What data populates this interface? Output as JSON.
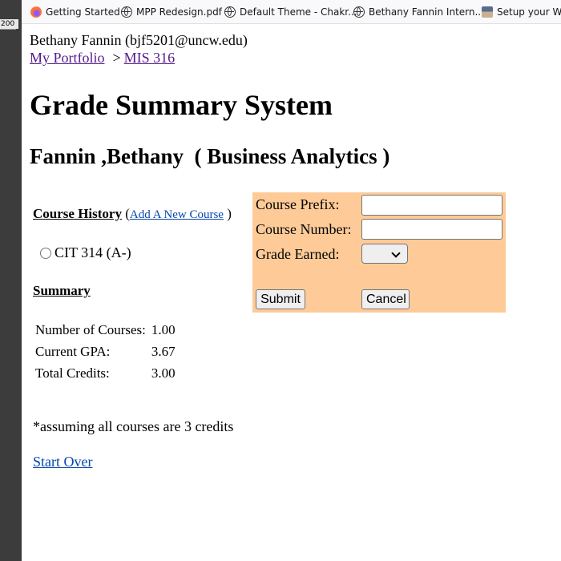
{
  "browser": {
    "ruler_value": "200",
    "bookmarks": [
      {
        "label": "Getting Started",
        "icon": "firefox-icon"
      },
      {
        "label": "MPP Redesign.pdf",
        "icon": "globe-icon"
      },
      {
        "label": "Default Theme - Chakr...",
        "icon": "globe-icon"
      },
      {
        "label": "Bethany Fannin Intern...",
        "icon": "globe-icon"
      },
      {
        "label": "Setup your Wo",
        "icon": "setup-icon"
      }
    ]
  },
  "header": {
    "user": "Bethany Fannin (bjf5201@uncw.edu)",
    "breadcrumb": {
      "home": "My Portfolio",
      "separator": ">",
      "current": "MIS 316"
    }
  },
  "title": "Grade Summary System",
  "student_heading": "Fannin ,Bethany  ( Business Analytics )",
  "course_history": {
    "heading": "Course History",
    "open_paren": "(",
    "add_link": "Add A New Course",
    "close_paren": ")",
    "courses": [
      {
        "label": "CIT 314 (A-)",
        "selected": false
      }
    ]
  },
  "summary": {
    "heading": "Summary",
    "rows": [
      {
        "label": "Number of Courses:",
        "value": "1.00"
      },
      {
        "label": "Current GPA:",
        "value": "3.67"
      },
      {
        "label": "Total Credits:",
        "value": "3.00"
      }
    ]
  },
  "note": "*assuming all courses are 3 credits",
  "start_over": "Start Over",
  "form": {
    "background": "#fecb98",
    "prefix_label": "Course Prefix:",
    "prefix_value": "",
    "number_label": "Course Number:",
    "number_value": "",
    "grade_label": "Grade Earned:",
    "grade_value": "",
    "submit_label": "Submit",
    "cancel_label": "Cancel"
  }
}
